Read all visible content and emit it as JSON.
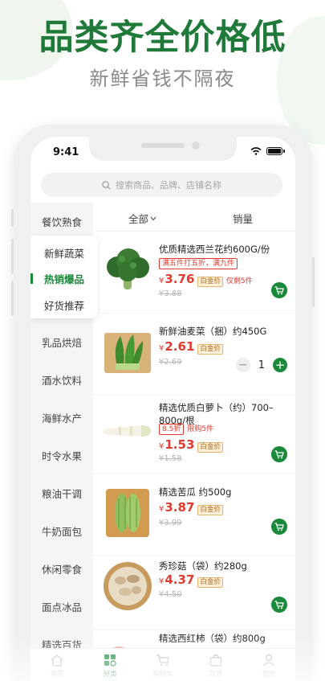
{
  "hero": {
    "title": "品类齐全价格低",
    "subtitle": "新鲜省钱不隔夜"
  },
  "status_bar": {
    "time": "9:41"
  },
  "search": {
    "placeholder": "搜索商品、品牌、店铺名称"
  },
  "sidebar": {
    "top_item": "餐饮熟食",
    "group": [
      "新鲜蔬菜",
      "热销爆品",
      "好货推荐"
    ],
    "active_item": "热销爆品",
    "items": [
      "乳品烘焙",
      "酒水饮料",
      "海鲜水产",
      "时令水果",
      "粮油干调",
      "牛奶面包",
      "休闲零食",
      "面点冰品",
      "精选百货"
    ]
  },
  "sort": {
    "all_label": "全部",
    "sales_label": "销量"
  },
  "products": [
    {
      "name": "优质精选西兰花约600G/份",
      "tags": [
        "满五件打五折，满九件"
      ],
      "price": "3.76",
      "badge": "白金价",
      "stock_note": "仅剩5件",
      "old_price": "¥3.88",
      "action": "cart",
      "image": "broccoli"
    },
    {
      "name": "新鲜油麦菜（捆）约450G",
      "tags": [],
      "price": "2.61",
      "badge": "白金价",
      "old_price": "¥2.69",
      "action": "stepper",
      "qty": "1",
      "image": "lettuce"
    },
    {
      "name": "精选优质白萝卜（约）700–800g/根",
      "tags": [
        "8.5折"
      ],
      "limit_note": "限购5件",
      "price": "1.53",
      "badge": "白金价",
      "old_price": "¥1.58",
      "action": "cart",
      "image": "radish"
    },
    {
      "name": "精选苦瓜 约500g",
      "tags": [],
      "price": "3.87",
      "badge": "白金价",
      "old_price": "¥3.99",
      "action": "cart",
      "image": "bitter-melon"
    },
    {
      "name": "秀珍菇（袋）约280g",
      "tags": [],
      "price": "4.37",
      "badge": "白金价",
      "old_price": "¥4.50",
      "action": "cart",
      "image": "mushroom"
    },
    {
      "name": "精选西红柿（袋）约800g",
      "tags": [],
      "image": "tomato"
    }
  ],
  "currency_symbol": "¥",
  "tabbar": [
    {
      "label": "首页",
      "icon": "home-icon"
    },
    {
      "label": "分类",
      "icon": "category-icon",
      "active": true
    },
    {
      "label": "购物车",
      "icon": "cart-icon"
    },
    {
      "label": "取货",
      "icon": "bag-icon"
    },
    {
      "label": "我的",
      "icon": "user-icon"
    }
  ],
  "colors": {
    "brand_green": "#1a8a3a",
    "hero_green": "#1f7a3a",
    "price_red": "#e23a2e",
    "gold_badge": "#a86a1e"
  }
}
